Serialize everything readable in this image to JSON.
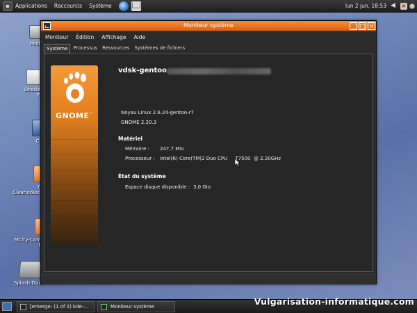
{
  "top_panel": {
    "menus": [
      "Applications",
      "Raccourcis",
      "Système"
    ],
    "clock": "lun  2 jun, 18:53"
  },
  "desktop": {
    "icons": [
      "Poste",
      "Dossier",
      "R",
      "C",
      "C",
      "ClearlooksC",
      "MCity-Com",
      "h",
      "Splash-Dual-"
    ]
  },
  "window": {
    "title": "Moniteur système",
    "menu": [
      "Moniteur",
      "Édition",
      "Affichage",
      "Aide"
    ],
    "tabs": [
      "Système",
      "Processus",
      "Ressources",
      "Systèmes de fichiers"
    ],
    "active_tab": "Système",
    "logo_text": "GNOME",
    "logo_tm": "™",
    "hostname": "vdsk-gentoo",
    "kernel": "Noyau Linux 2.6.24-gentoo-r7",
    "gnome_version": "GNOME 2.20.3",
    "hardware": {
      "heading": "Matériel",
      "memory_label": "Mémoire :",
      "memory_value": "247,7 Mio",
      "cpu_label": "Processeur :",
      "cpu_value": "Intel(R) Core(TM)2 Duo CPU     T7500  @ 2.20GHz"
    },
    "status": {
      "heading": "État du système",
      "disk_label": "Espace disque disponible :",
      "disk_value": "3,0 Gio"
    }
  },
  "taskbar": {
    "tasks": [
      "[emerge: (1 of 2) kde-...",
      "Moniteur système"
    ]
  },
  "watermark": "Vulgarisation-informatique.com",
  "colors": {
    "titlebar": "#e8731e",
    "window_bg": "#2b2b2b",
    "desktop": "#6f86b8"
  }
}
